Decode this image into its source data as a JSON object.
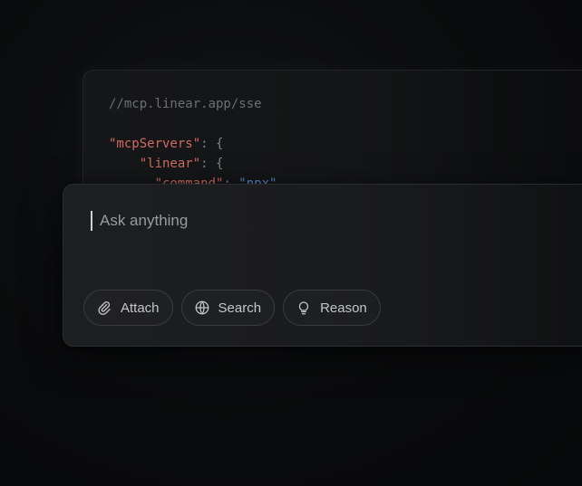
{
  "code_card": {
    "comment": "//mcp.linear.app/sse",
    "lines": {
      "servers_key": "\"mcpServers\"",
      "servers_punct": ": {",
      "linear_key": "\"linear\"",
      "linear_punct": ": {",
      "command_key": "\"command\"",
      "command_punct": ": ",
      "command_value": "\"npx\""
    }
  },
  "prompt": {
    "placeholder": "Ask anything",
    "value": ""
  },
  "actions": [
    {
      "label": "Attach",
      "icon": "paperclip-icon"
    },
    {
      "label": "Search",
      "icon": "globe-icon"
    },
    {
      "label": "Reason",
      "icon": "lightbulb-icon"
    }
  ]
}
